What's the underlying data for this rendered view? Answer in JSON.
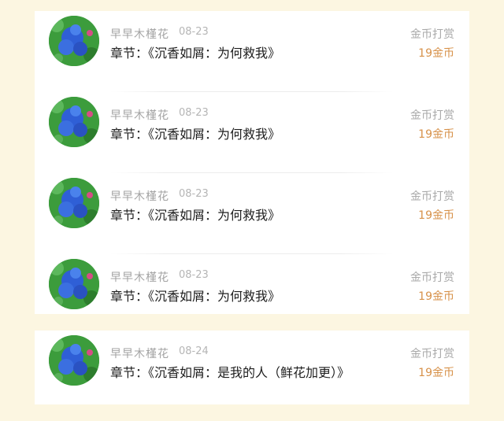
{
  "colors": {
    "background": "#fcf6e1",
    "card": "#ffffff",
    "coin_amount": "#d79149",
    "meta_text": "#a3a3a3",
    "chapter_text": "#1e1e1e"
  },
  "records": [
    {
      "user": "早早木槿花",
      "date": "08-23",
      "chapter": "章节：《沉香如屑：为何救我》",
      "action": "金币打赏",
      "amount": "19金币",
      "avatar_icon": "blue-flower-avatar"
    },
    {
      "user": "早早木槿花",
      "date": "08-23",
      "chapter": "章节：《沉香如屑：为何救我》",
      "action": "金币打赏",
      "amount": "19金币",
      "avatar_icon": "blue-flower-avatar"
    },
    {
      "user": "早早木槿花",
      "date": "08-23",
      "chapter": "章节：《沉香如屑：为何救我》",
      "action": "金币打赏",
      "amount": "19金币",
      "avatar_icon": "blue-flower-avatar"
    },
    {
      "user": "早早木槿花",
      "date": "08-23",
      "chapter": "章节：《沉香如屑：为何救我》",
      "action": "金币打赏",
      "amount": "19金币",
      "avatar_icon": "blue-flower-avatar"
    },
    {
      "user": "早早木槿花",
      "date": "08-24",
      "chapter": "章节：《沉香如屑：是我的人（鲜花加更）》",
      "action": "金币打赏",
      "amount": "19金币",
      "avatar_icon": "blue-flower-avatar"
    }
  ]
}
